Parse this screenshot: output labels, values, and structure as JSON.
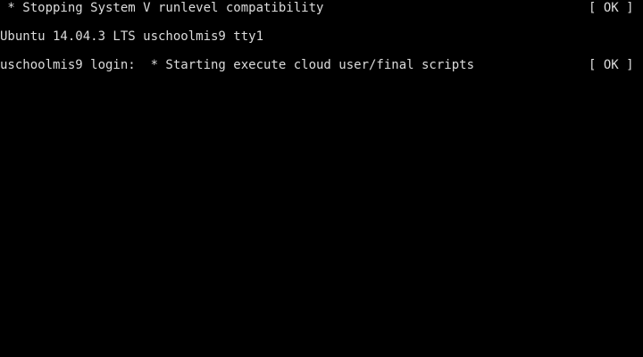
{
  "terminal": {
    "lines": [
      {
        "text": " * Stopping System V runlevel compatibility",
        "status": "[ OK ]"
      },
      {
        "text": "Ubuntu 14.04.3 LTS uschoolmis9 tty1",
        "status": ""
      },
      {
        "text": "uschoolmis9 login:  * Starting execute cloud user/final scripts",
        "status": "[ OK ]"
      }
    ],
    "colors": {
      "background": "#000000",
      "foreground": "#dcdcdc"
    }
  }
}
